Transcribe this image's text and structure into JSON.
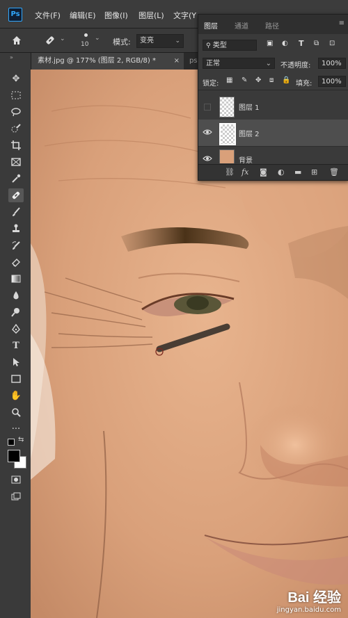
{
  "menubar": {
    "logo": "Ps",
    "items": [
      "文件(F)",
      "编辑(E)",
      "图像(I)",
      "图层(L)",
      "文字(Y"
    ]
  },
  "options": {
    "brush_size": "10",
    "mode_label": "模式:",
    "mode_value": "变亮"
  },
  "tabs": {
    "active": "素材.jpg @ 177% (图层 2, RGB/8) *",
    "close": "×",
    "next": "psd"
  },
  "layers_panel": {
    "tabs": [
      "图层",
      "通道",
      "路径"
    ],
    "filter": "类型",
    "blend_mode": "正常",
    "opacity_label": "不透明度:",
    "opacity_value": "100%",
    "lock_label": "锁定:",
    "fill_label": "填充:",
    "fill_value": "100%",
    "layers": [
      {
        "name": "图层 1",
        "visible": false
      },
      {
        "name": "图层 2",
        "visible": true,
        "selected": true
      },
      {
        "name": "背景",
        "visible": true
      }
    ]
  },
  "watermark": {
    "brand": "Bai  经验",
    "url": "jingyan.baidu.com"
  },
  "colors": {
    "foreground": "#000000",
    "background": "#ffffff",
    "accent": "#31a8ff"
  }
}
